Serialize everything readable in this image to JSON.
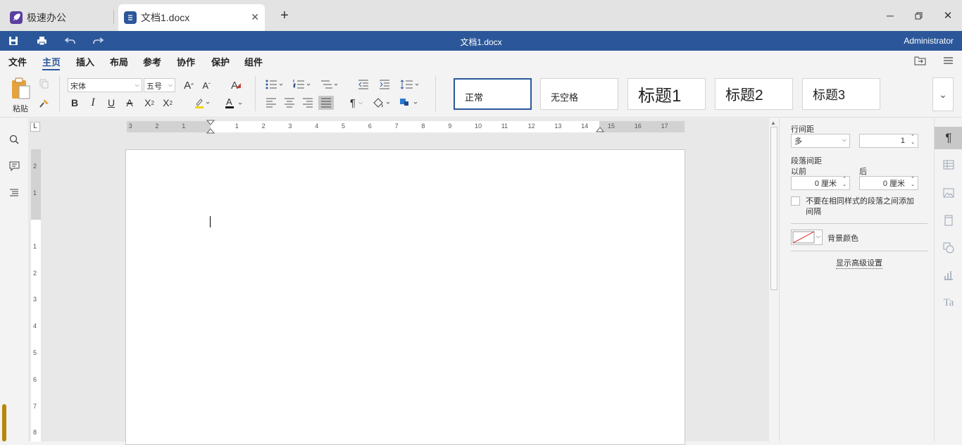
{
  "tabs": [
    {
      "label": "极速办公"
    },
    {
      "label": "文档1.docx"
    }
  ],
  "titlebar": {
    "title": "文档1.docx",
    "user": "Administrator"
  },
  "menu": [
    "文件",
    "主页",
    "插入",
    "布局",
    "参考",
    "协作",
    "保护",
    "组件"
  ],
  "ribbon": {
    "paste_label": "粘贴",
    "font_name": "宋体",
    "font_size": "五号",
    "styles": [
      "正常",
      "无空格",
      "标题1",
      "标题2",
      "标题3"
    ]
  },
  "ruler": {
    "h_labels": [
      "3",
      "2",
      "1",
      "1",
      "2",
      "3",
      "4",
      "5",
      "6",
      "7",
      "8",
      "9",
      "10",
      "11",
      "12",
      "13",
      "14",
      "15",
      "16",
      "17"
    ],
    "v_labels": [
      "2",
      "1",
      "1",
      "2",
      "3",
      "4",
      "5",
      "6",
      "7",
      "8"
    ]
  },
  "panel": {
    "line_spacing_label": "行间距",
    "line_spacing_mode": "多",
    "line_spacing_value": "1",
    "para_spacing_label": "段落间距",
    "before_label": "以前",
    "after_label": "后",
    "before_value": "0 厘米",
    "after_value": "0 厘米",
    "no_space_label": "不要在相同样式的段落之间添加间隔",
    "bg_color_label": "背景颜色",
    "advanced_link": "显示高级设置"
  },
  "colors": {
    "accent": "#2b579a",
    "tab_icon_app": "#5b3fa0"
  }
}
